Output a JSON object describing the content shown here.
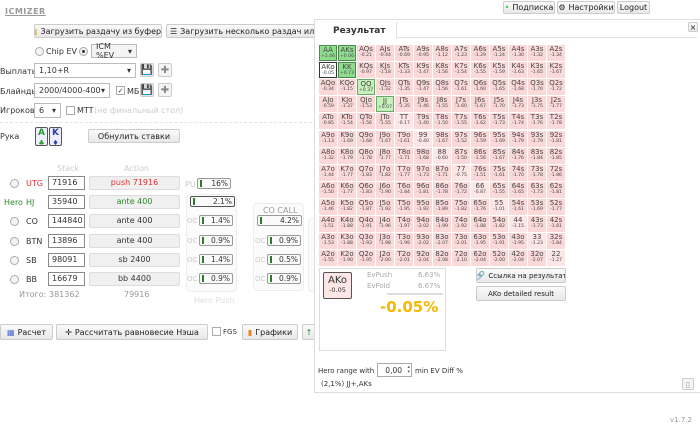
{
  "app": {
    "logo": "ICMIZER",
    "version": "v1.7.2"
  },
  "topbar": {
    "subscription": "Подписка",
    "settings": "Настройки",
    "logout": "Logout"
  },
  "toolbar": {
    "load_clipboard": "Загрузить раздачу из буфера",
    "load_multiple": "Загрузить несколько раздач или тур"
  },
  "mode": {
    "chip_ev": "Chip EV",
    "icm": "ICM %EV"
  },
  "payouts": {
    "label": "Выплаты",
    "value": "1,10+R"
  },
  "blinds": {
    "label": "Блайнды",
    "value": "2000/4000-400",
    "mb_label": "МБ",
    "mb_checked": true
  },
  "players": {
    "label": "Игроков",
    "value": "6",
    "mtt_label": "MTT",
    "mtt_hint": "(не финальный стол)"
  },
  "hand": {
    "label": "Рука",
    "card1": "A",
    "card2": "K",
    "reset": "Обнулить ставки"
  },
  "table": {
    "stack_header": "Stack",
    "action_header": "Action",
    "rows": [
      {
        "hero": "",
        "pos": "UTG",
        "stack": "71916",
        "action": "push 71916"
      },
      {
        "hero": "Hero",
        "pos": "HJ",
        "stack": "35940",
        "action": "ante 400"
      },
      {
        "hero": "",
        "pos": "CO",
        "stack": "144840",
        "action": "ante 400"
      },
      {
        "hero": "",
        "pos": "BTN",
        "stack": "13896",
        "action": "ante 400"
      },
      {
        "hero": "",
        "pos": "SB",
        "stack": "98091",
        "action": "sb 2400"
      },
      {
        "hero": "",
        "pos": "BB",
        "stack": "16679",
        "action": "bb 4400"
      }
    ],
    "total_label": "Итого:",
    "total_stack": "381362",
    "total_action": "79916"
  },
  "ranges": {
    "pu_label": "PU",
    "pu_value": "16%",
    "oc": "OC",
    "hero_push": {
      "title": "Hero Push",
      "values": [
        "2.1%",
        "1.4%",
        "0.9%",
        "1.4%",
        "0.9%"
      ]
    },
    "co_call": {
      "title": "CO CALL",
      "values": [
        "4.2%",
        "0.9%",
        "0.5%",
        "0.9%"
      ]
    }
  },
  "bottom": {
    "calc": "Расчет",
    "nash": "Рассчитать равновесие Нэша",
    "fgs": "FGS",
    "charts": "Графики"
  },
  "result": {
    "tab": "Результат",
    "close": "×",
    "grid": [
      [
        [
          "AA",
          "+1.46"
        ],
        [
          "AKs",
          "+0.06"
        ],
        [
          "AQs",
          "-0.21"
        ],
        [
          "AJs",
          "-0.44"
        ],
        [
          "ATs",
          "-0.69"
        ],
        [
          "A9s",
          "-0.95"
        ],
        [
          "A8s",
          "-1.12"
        ],
        [
          "A7s",
          "-1.23"
        ],
        [
          "A6s",
          "-1.29"
        ],
        [
          "A5s",
          "-1.24"
        ],
        [
          "A4s",
          "-1.30"
        ],
        [
          "A3s",
          "-1.32"
        ],
        [
          "A2s",
          "-1.34"
        ]
      ],
      [
        [
          "AKo",
          "-0.05"
        ],
        [
          "KK",
          "+0.73"
        ],
        [
          "KQs",
          "-0.97"
        ],
        [
          "KJs",
          "-1.18"
        ],
        [
          "KTs",
          "-1.33"
        ],
        [
          "K9s",
          "-1.47"
        ],
        [
          "K8s",
          "-1.56"
        ],
        [
          "K7s",
          "-1.54"
        ],
        [
          "K6s",
          "-1.55"
        ],
        [
          "K5s",
          "-1.59"
        ],
        [
          "K4s",
          "-1.63"
        ],
        [
          "K3s",
          "-1.65"
        ],
        [
          "K2s",
          "-1.67"
        ]
      ],
      [
        [
          "AQo",
          "-0.34"
        ],
        [
          "KQo",
          "-1.15"
        ],
        [
          "QQ",
          "+0.37"
        ],
        [
          "QJs",
          "-1.32"
        ],
        [
          "QTs",
          "-1.35"
        ],
        [
          "Q9s",
          "-1.47"
        ],
        [
          "Q8s",
          "-1.56"
        ],
        [
          "Q7s",
          "-1.61"
        ],
        [
          "Q6s",
          "-1.60"
        ],
        [
          "Q5s",
          "-1.65"
        ],
        [
          "Q4s",
          "-1.68"
        ],
        [
          "Q3s",
          "-1.70"
        ],
        [
          "Q2s",
          "-1.72"
        ]
      ],
      [
        [
          "AJo",
          "-0.59"
        ],
        [
          "KJo",
          "-1.37"
        ],
        [
          "QJo",
          "-1.53"
        ],
        [
          "JJ",
          "+0.07"
        ],
        [
          "JTs",
          "-1.35"
        ],
        [
          "J9s",
          "-1.46"
        ],
        [
          "J8s",
          "-1.55"
        ],
        [
          "J7s",
          "-1.60"
        ],
        [
          "J6s",
          "-1.67"
        ],
        [
          "J5s",
          "-1.70"
        ],
        [
          "J4s",
          "-1.73"
        ],
        [
          "J3s",
          "-1.75"
        ],
        [
          "J2s",
          "-1.77"
        ]
      ],
      [
        [
          "ATo",
          "-0.85"
        ],
        [
          "KTo",
          "-1.54"
        ],
        [
          "QTo",
          "-1.56"
        ],
        [
          "JTo",
          "-1.55"
        ],
        [
          "TT",
          "-0.17"
        ],
        [
          "T9s",
          "-1.40"
        ],
        [
          "T8s",
          "-1.50"
        ],
        [
          "T7s",
          "-1.55"
        ],
        [
          "T6s",
          "-1.62"
        ],
        [
          "T5s",
          "-1.73"
        ],
        [
          "T4s",
          "-1.74"
        ],
        [
          "T3s",
          "-1.76"
        ],
        [
          "T2s",
          "-1.78"
        ]
      ],
      [
        [
          "A9o",
          "-1.13"
        ],
        [
          "K9o",
          "-1.69"
        ],
        [
          "Q9o",
          "-1.68"
        ],
        [
          "J9o",
          "-1.67"
        ],
        [
          "T9o",
          "-1.61"
        ],
        [
          "99",
          "-0.40"
        ],
        [
          "98s",
          "-1.67"
        ],
        [
          "97s",
          "-1.52"
        ],
        [
          "96s",
          "-1.59"
        ],
        [
          "95s",
          "-1.69"
        ],
        [
          "94s",
          "-1.79"
        ],
        [
          "93s",
          "-1.79"
        ],
        [
          "92s",
          "-1.81"
        ]
      ],
      [
        [
          "A8o",
          "-1.32"
        ],
        [
          "K8o",
          "-1.79"
        ],
        [
          "Q8o",
          "-1.78"
        ],
        [
          "J8o",
          "-1.77"
        ],
        [
          "T8o",
          "-1.71"
        ],
        [
          "98o",
          "-1.68"
        ],
        [
          "88",
          "-0.60"
        ],
        [
          "87s",
          "-1.50"
        ],
        [
          "86s",
          "-1.56"
        ],
        [
          "85s",
          "-1.67"
        ],
        [
          "84s",
          "-1.76"
        ],
        [
          "83s",
          "-1.84"
        ],
        [
          "82s",
          "-1.85"
        ]
      ],
      [
        [
          "A7o",
          "-1.44"
        ],
        [
          "K7o",
          "-1.77"
        ],
        [
          "Q7o",
          "-1.83"
        ],
        [
          "J7o",
          "-1.82"
        ],
        [
          "T7o",
          "-1.77"
        ],
        [
          "97o",
          "-1.73"
        ],
        [
          "87o",
          "-1.71"
        ],
        [
          "77",
          "-0.75"
        ],
        [
          "76s",
          "-1.51"
        ],
        [
          "75s",
          "-1.61"
        ],
        [
          "74s",
          "-1.70"
        ],
        [
          "73s",
          "-1.78"
        ],
        [
          "72s",
          "-1.86"
        ]
      ],
      [
        [
          "A6o",
          "-1.50"
        ],
        [
          "K6o",
          "-1.77"
        ],
        [
          "Q6o",
          "-1.83"
        ],
        [
          "J6o",
          "-1.90"
        ],
        [
          "T6o",
          "-1.84"
        ],
        [
          "96o",
          "-1.81"
        ],
        [
          "86o",
          "-1.78"
        ],
        [
          "76o",
          "-1.72"
        ],
        [
          "66",
          "-0.87"
        ],
        [
          "65s",
          "-1.55"
        ],
        [
          "64s",
          "-1.65"
        ],
        [
          "63s",
          "-1.73"
        ],
        [
          "62s",
          "-1.81"
        ]
      ],
      [
        [
          "A5o",
          "-1.46"
        ],
        [
          "K5o",
          "-1.82"
        ],
        [
          "Q5o",
          "-1.87"
        ],
        [
          "J5o",
          "-1.92"
        ],
        [
          "T5o",
          "-1.95"
        ],
        [
          "95o",
          "-1.92"
        ],
        [
          "85o",
          "-1.89"
        ],
        [
          "75o",
          "-1.82"
        ],
        [
          "65o",
          "-1.76"
        ],
        [
          "55",
          "-1.01"
        ],
        [
          "54s",
          "-1.61"
        ],
        [
          "53s",
          "-1.69"
        ],
        [
          "52s",
          "-1.77"
        ]
      ],
      [
        [
          "A4o",
          "-1.51"
        ],
        [
          "K4o",
          "-1.88"
        ],
        [
          "Q4o",
          "-1.91"
        ],
        [
          "J4o",
          "-1.96"
        ],
        [
          "T4o",
          "-1.97"
        ],
        [
          "94o",
          "-2.02"
        ],
        [
          "84o",
          "-1.99"
        ],
        [
          "74o",
          "-1.92"
        ],
        [
          "64o",
          "-1.88"
        ],
        [
          "54o",
          "-1.82"
        ],
        [
          "44",
          "-1.15"
        ],
        [
          "43s",
          "-1.73"
        ],
        [
          "42s",
          "-1.81"
        ]
      ],
      [
        [
          "A3o",
          "-1.53"
        ],
        [
          "K3o",
          "-1.88"
        ],
        [
          "Q3o",
          "-1.93"
        ],
        [
          "J3o",
          "-1.98"
        ],
        [
          "T3o",
          "-1.99"
        ],
        [
          "93o",
          "-2.02"
        ],
        [
          "83o",
          "-2.07"
        ],
        [
          "73o",
          "-2.01"
        ],
        [
          "63o",
          "-1.95"
        ],
        [
          "53o",
          "-1.91"
        ],
        [
          "43o",
          "-1.95"
        ],
        [
          "33",
          "-1.23"
        ],
        [
          "32s",
          "-1.84"
        ]
      ],
      [
        [
          "A2o",
          "-1.55"
        ],
        [
          "K2o",
          "-1.90"
        ],
        [
          "Q2o",
          "-1.95"
        ],
        [
          "J2o",
          "-2.00"
        ],
        [
          "T2o",
          "-2.01"
        ],
        [
          "92o",
          "-2.04"
        ],
        [
          "82o",
          "-2.08"
        ],
        [
          "72o",
          "-2.10"
        ],
        [
          "62o",
          "-2.04"
        ],
        [
          "52o",
          "-2.00"
        ],
        [
          "42o",
          "-2.04"
        ],
        [
          "32o",
          "-2.07"
        ],
        [
          "22",
          "-1.27"
        ]
      ]
    ],
    "push_hands": [
      "AA",
      "AKs",
      "KK",
      "QQ",
      "JJ"
    ],
    "selected": {
      "hand": "AKo",
      "value": "-0.05",
      "ev_push_label": "EvPush",
      "ev_push": "6.63%",
      "ev_fold_label": "EvFold",
      "ev_fold": "6.67%",
      "diff": "-0.05%"
    },
    "link_btn": "Ссылка на результат",
    "detail_btn": "AKo detailed result",
    "hero_range_label": "Hero range with",
    "min_ev": "0,00",
    "min_ev_label": "min EV Diff %",
    "range_text": "(2,1%) JJ+,AKs"
  },
  "colors": {
    "push_strong": "#8fdc8f",
    "push_light": "#c8f0bc",
    "fold": "#fbd9d9",
    "diff": "#f5b800",
    "utg": "#e53030",
    "hero": "#2a8a2a"
  }
}
